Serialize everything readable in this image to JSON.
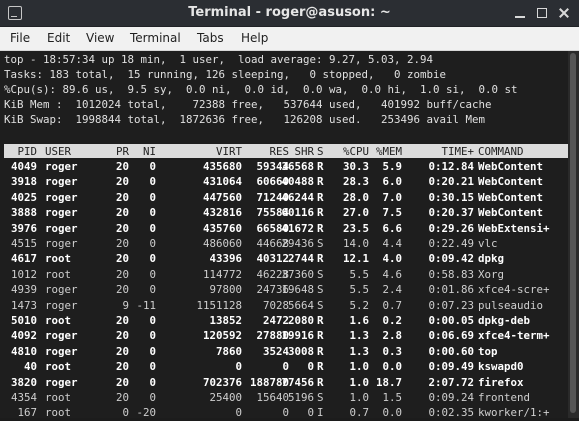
{
  "window": {
    "title": "Terminal - roger@asuson: ~"
  },
  "menu": [
    "File",
    "Edit",
    "View",
    "Terminal",
    "Tabs",
    "Help"
  ],
  "summary": [
    "top - 18:57:34 up 18 min,  1 user,  load average: 9.27, 5.03, 2.94",
    "Tasks: 183 total,  15 running, 126 sleeping,   0 stopped,   0 zombie",
    "%Cpu(s): 89.6 us,  9.5 sy,  0.0 ni,  0.0 id,  0.0 wa,  0.0 hi,  1.0 si,  0.0 st",
    "KiB Mem :  1012024 total,    72388 free,   537644 used,   401992 buff/cache",
    "KiB Swap:  1998844 total,  1872636 free,   126208 used.   253496 avail Mem"
  ],
  "columns": [
    "PID",
    "USER",
    "PR",
    "NI",
    "VIRT",
    "RES",
    "SHR",
    "S",
    "%CPU",
    "%MEM",
    "TIME+",
    "COMMAND"
  ],
  "processes": [
    {
      "pid": "4049",
      "user": "roger",
      "pr": "20",
      "ni": "0",
      "virt": "435680",
      "res": "59344",
      "shr": "36568",
      "s": "R",
      "cpu": "30.3",
      "mem": "5.9",
      "time": "0:12.84",
      "cmd": "WebContent",
      "running": true
    },
    {
      "pid": "3918",
      "user": "roger",
      "pr": "20",
      "ni": "0",
      "virt": "431064",
      "res": "60660",
      "shr": "40488",
      "s": "R",
      "cpu": "28.3",
      "mem": "6.0",
      "time": "0:20.21",
      "cmd": "WebContent",
      "running": true
    },
    {
      "pid": "4025",
      "user": "roger",
      "pr": "20",
      "ni": "0",
      "virt": "447560",
      "res": "71240",
      "shr": "46244",
      "s": "R",
      "cpu": "28.0",
      "mem": "7.0",
      "time": "0:30.15",
      "cmd": "WebContent",
      "running": true
    },
    {
      "pid": "3888",
      "user": "roger",
      "pr": "20",
      "ni": "0",
      "virt": "432816",
      "res": "75584",
      "shr": "60116",
      "s": "R",
      "cpu": "27.0",
      "mem": "7.5",
      "time": "0:20.37",
      "cmd": "WebContent",
      "running": true
    },
    {
      "pid": "3976",
      "user": "roger",
      "pr": "20",
      "ni": "0",
      "virt": "435760",
      "res": "66580",
      "shr": "41672",
      "s": "R",
      "cpu": "23.5",
      "mem": "6.6",
      "time": "0:29.26",
      "cmd": "WebExtensi+",
      "running": true
    },
    {
      "pid": "4515",
      "user": "roger",
      "pr": "20",
      "ni": "0",
      "virt": "486060",
      "res": "44668",
      "shr": "29436",
      "s": "S",
      "cpu": "14.0",
      "mem": "4.4",
      "time": "0:22.49",
      "cmd": "vlc",
      "running": false
    },
    {
      "pid": "4617",
      "user": "root",
      "pr": "20",
      "ni": "0",
      "virt": "43396",
      "res": "40312",
      "shr": "2744",
      "s": "R",
      "cpu": "12.1",
      "mem": "4.0",
      "time": "0:09.42",
      "cmd": "dpkg",
      "running": true
    },
    {
      "pid": "1012",
      "user": "root",
      "pr": "20",
      "ni": "0",
      "virt": "114772",
      "res": "46228",
      "shr": "37360",
      "s": "S",
      "cpu": "5.5",
      "mem": "4.6",
      "time": "0:58.83",
      "cmd": "Xorg",
      "running": false
    },
    {
      "pid": "4939",
      "user": "roger",
      "pr": "20",
      "ni": "0",
      "virt": "97800",
      "res": "24736",
      "shr": "19648",
      "s": "S",
      "cpu": "5.5",
      "mem": "2.4",
      "time": "0:01.86",
      "cmd": "xfce4-scre+",
      "running": false
    },
    {
      "pid": "1473",
      "user": "roger",
      "pr": "9",
      "ni": "-11",
      "virt": "1151128",
      "res": "7028",
      "shr": "5664",
      "s": "S",
      "cpu": "5.2",
      "mem": "0.7",
      "time": "0:07.23",
      "cmd": "pulseaudio",
      "running": false
    },
    {
      "pid": "5010",
      "user": "root",
      "pr": "20",
      "ni": "0",
      "virt": "13852",
      "res": "2472",
      "shr": "2080",
      "s": "R",
      "cpu": "1.6",
      "mem": "0.2",
      "time": "0:00.05",
      "cmd": "dpkg-deb",
      "running": true
    },
    {
      "pid": "4092",
      "user": "roger",
      "pr": "20",
      "ni": "0",
      "virt": "120592",
      "res": "27880",
      "shr": "19916",
      "s": "R",
      "cpu": "1.3",
      "mem": "2.8",
      "time": "0:06.69",
      "cmd": "xfce4-term+",
      "running": true
    },
    {
      "pid": "4810",
      "user": "roger",
      "pr": "20",
      "ni": "0",
      "virt": "7860",
      "res": "3524",
      "shr": "3008",
      "s": "R",
      "cpu": "1.3",
      "mem": "0.3",
      "time": "0:00.60",
      "cmd": "top",
      "running": true
    },
    {
      "pid": "40",
      "user": "root",
      "pr": "20",
      "ni": "0",
      "virt": "0",
      "res": "0",
      "shr": "0",
      "s": "R",
      "cpu": "1.0",
      "mem": "0.0",
      "time": "0:09.49",
      "cmd": "kswapd0",
      "running": true
    },
    {
      "pid": "3820",
      "user": "roger",
      "pr": "20",
      "ni": "0",
      "virt": "702376",
      "res": "188780",
      "shr": "77456",
      "s": "R",
      "cpu": "1.0",
      "mem": "18.7",
      "time": "2:07.72",
      "cmd": "firefox",
      "running": true
    },
    {
      "pid": "4354",
      "user": "root",
      "pr": "20",
      "ni": "0",
      "virt": "25400",
      "res": "15640",
      "shr": "5196",
      "s": "S",
      "cpu": "1.0",
      "mem": "1.5",
      "time": "0:09.24",
      "cmd": "frontend",
      "running": false
    },
    {
      "pid": "167",
      "user": "root",
      "pr": "0",
      "ni": "-20",
      "virt": "0",
      "res": "0",
      "shr": "0",
      "s": "I",
      "cpu": "0.7",
      "mem": "0.0",
      "time": "0:02.35",
      "cmd": "kworker/1:+",
      "running": false
    }
  ]
}
